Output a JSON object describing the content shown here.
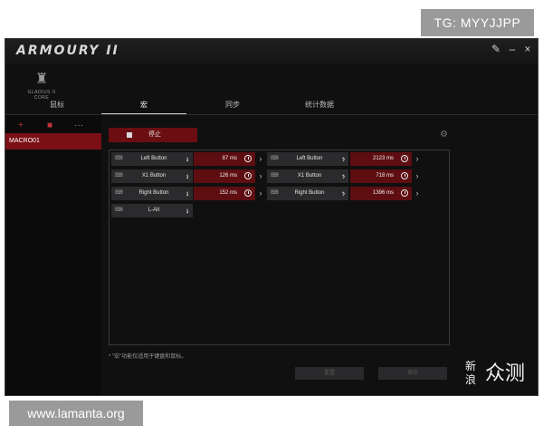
{
  "watermarks": {
    "top": "TG: MYYJJPP",
    "bottom": "www.lamanta.org",
    "site_logo": [
      "新",
      "浪"
    ],
    "site_name": "众测"
  },
  "app": {
    "title": "ARMOURY II",
    "device_name": "GLADIUS II CORE"
  },
  "window_controls": [
    "wrench-icon",
    "minimize-icon",
    "close-icon"
  ],
  "tabs": [
    {
      "label": "鼠标"
    },
    {
      "label": "宏",
      "active": true
    },
    {
      "label": "同步"
    },
    {
      "label": "统计数据"
    }
  ],
  "sidebar": {
    "tools": [
      "add-icon",
      "delete-icon",
      "more-icon"
    ],
    "macros": [
      "MACRO01"
    ]
  },
  "toolbar": {
    "stop_label": "停止"
  },
  "macro_events": {
    "row1": {
      "key1": "Left Button",
      "delay1": "87 ms",
      "key2": "Left Button",
      "delay2": "2123 ms"
    },
    "row2": {
      "key1": "X1 Button",
      "delay1": "126 ms",
      "key2": "X1 Button",
      "delay2": "718 ms"
    },
    "row3": {
      "key1": "Right Button",
      "delay1": "152 ms",
      "key2": "Right Button",
      "delay2": "1396 ms"
    },
    "row4": {
      "key1": "L-Alt"
    }
  },
  "glyphs": {
    "down": "↓",
    "up": "↑",
    "next": "›",
    "keyboard": "⌨"
  },
  "footer": {
    "note": "* \"宏\"功能仅适用于键盘和鼠标。",
    "button1": "重置",
    "button2": "保存"
  },
  "colors": {
    "accent_red": "#6a0e12",
    "selected_red": "#7a1015",
    "background": "#101011"
  }
}
